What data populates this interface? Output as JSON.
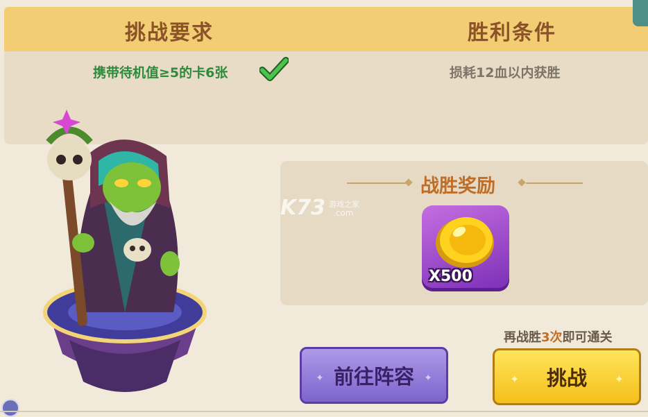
{
  "header": {
    "requirement_title": "挑战要求",
    "victory_title": "胜利条件"
  },
  "requirements": {
    "card_requirement": "携带待机值≥5的卡6张",
    "victory_condition": "损耗12血以内获胜"
  },
  "reward": {
    "title": "战胜奖励",
    "item_icon": "gold-coin-icon",
    "quantity": "X500"
  },
  "progress": {
    "prefix": "再战胜",
    "count": "3次",
    "suffix": "即可通关"
  },
  "buttons": {
    "lineup_label": "前往阵容",
    "challenge_label": "挑战"
  },
  "watermark": {
    "brand": "K73",
    "tagline": "游戏之家",
    "domain": ".com"
  },
  "colors": {
    "header": "#f3cd73",
    "requirement_met": "#2e8a3c",
    "reward_title": "#c06d27",
    "lineup_button": "#8c74d8",
    "challenge_button": "#f8d02a"
  }
}
